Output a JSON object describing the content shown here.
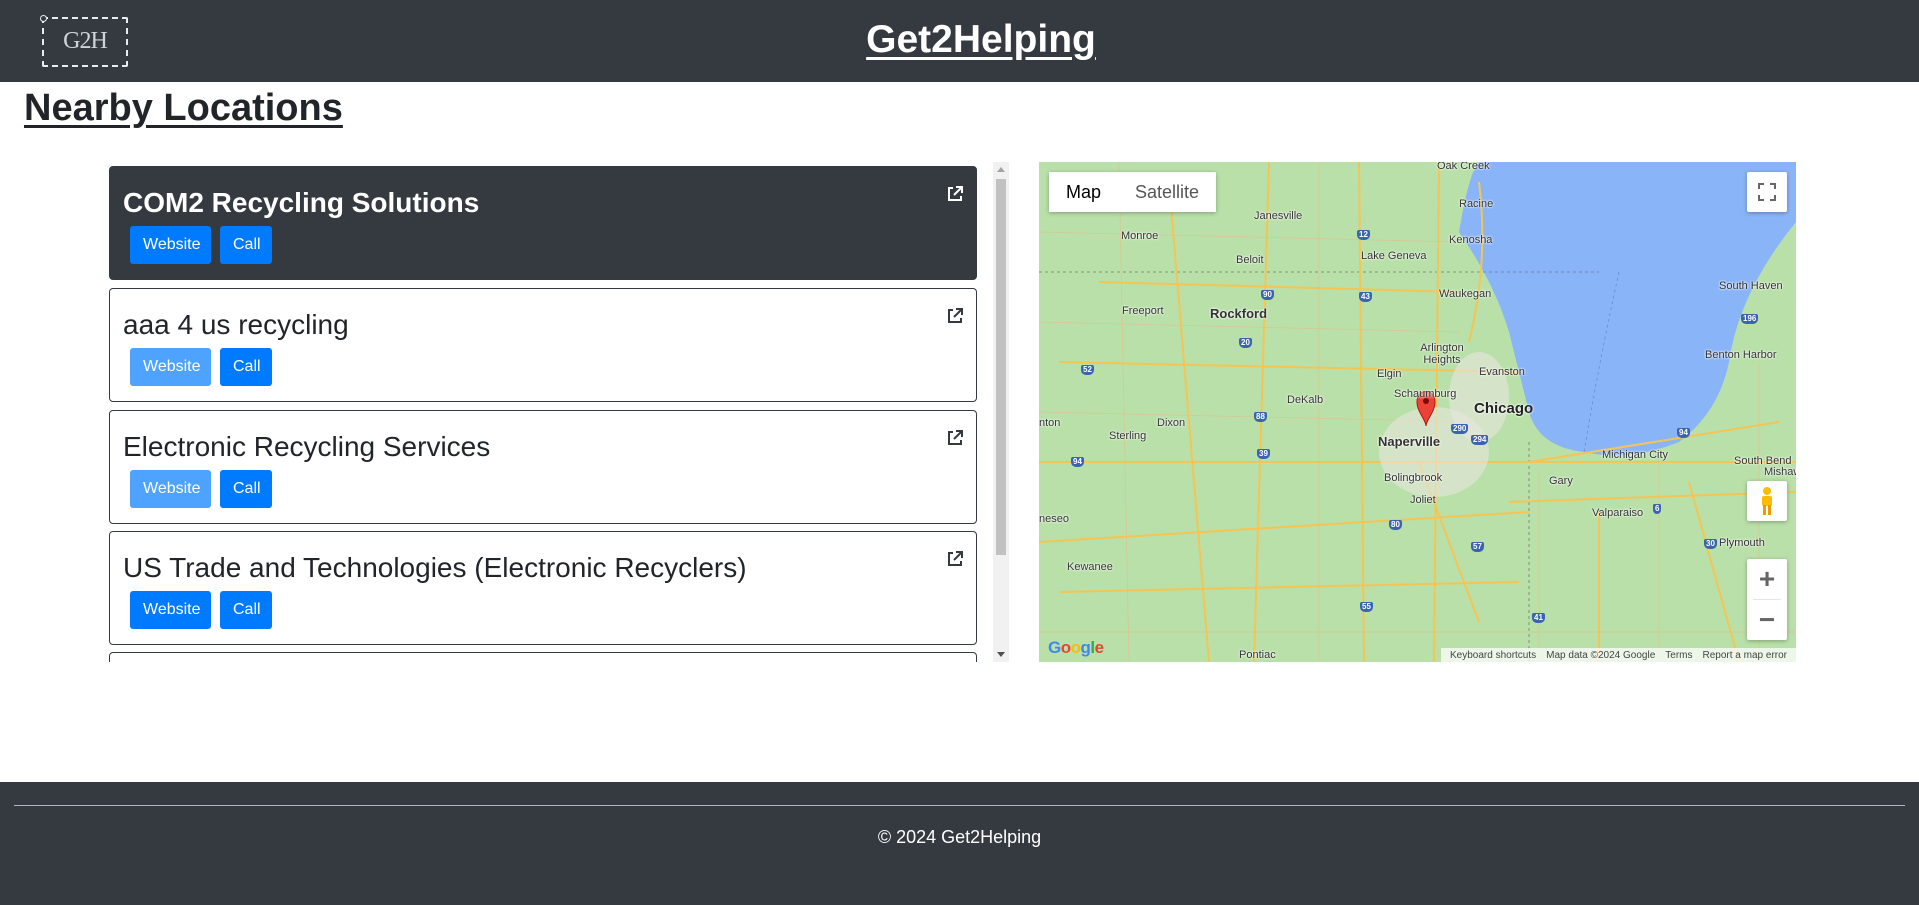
{
  "header": {
    "logo_text": "G2H",
    "brand": "Get2Helping"
  },
  "page": {
    "title": "Nearby Locations"
  },
  "locations": [
    {
      "name": "COM2 Recycling Solutions",
      "website_label": "Website",
      "call_label": "Call",
      "active": true,
      "website_enabled": true
    },
    {
      "name": "aaa 4 us recycling",
      "website_label": "Website",
      "call_label": "Call",
      "active": false,
      "website_enabled": false
    },
    {
      "name": "Electronic Recycling Services",
      "website_label": "Website",
      "call_label": "Call",
      "active": false,
      "website_enabled": false
    },
    {
      "name": "US Trade and Technologies (Electronic Recyclers)",
      "website_label": "Website",
      "call_label": "Call",
      "active": false,
      "website_enabled": true
    }
  ],
  "map": {
    "type_map": "Map",
    "type_satellite": "Satellite",
    "zoom_in": "+",
    "zoom_out": "−",
    "google": "Google",
    "footer": {
      "shortcuts": "Keyboard shortcuts",
      "data": "Map data ©2024 Google",
      "terms": "Terms",
      "report": "Report a map error"
    },
    "places": {
      "oak_creek": "Oak Creek",
      "racine": "Racine",
      "janesville": "Janesville",
      "kenosha": "Kenosha",
      "monroe": "Monroe",
      "beloit": "Beloit",
      "lake_geneva": "Lake Geneva",
      "waukegan": "Waukegan",
      "south_haven": "South Haven",
      "freeport": "Freeport",
      "rockford": "Rockford",
      "arlington_heights": "Arlington Heights",
      "benton_harbor": "Benton Harbor",
      "elgin": "Elgin",
      "evanston": "Evanston",
      "dekalb": "DeKalb",
      "schaumburg": "Schaumburg",
      "chicago": "Chicago",
      "sterling": "Sterling",
      "dixon": "Dixon",
      "naperville": "Naperville",
      "michigan_city": "Michigan City",
      "south_bend": "South Bend",
      "bolingbrook": "Bolingbrook",
      "gary": "Gary",
      "joliet": "Joliet",
      "valparaiso": "Valparaiso",
      "plymouth": "Plymouth",
      "kewanee": "Kewanee",
      "pontiac": "Pontiac",
      "dixon_left": "nton",
      "moline": "neseo",
      "mishawaka": "Mishawaka"
    },
    "shields": [
      "94",
      "12",
      "43",
      "90",
      "20",
      "52",
      "88",
      "39",
      "80",
      "55",
      "57",
      "65",
      "94",
      "196",
      "30",
      "6",
      "41",
      "294",
      "290",
      "74"
    ]
  },
  "footer": {
    "copyright": "© 2024 Get2Helping"
  },
  "colors": {
    "header_bg": "#343a40",
    "primary": "#007bff",
    "primary_faded": "#4da3ff",
    "lake": "#8ab4f8",
    "land": "#b8dfa8"
  }
}
